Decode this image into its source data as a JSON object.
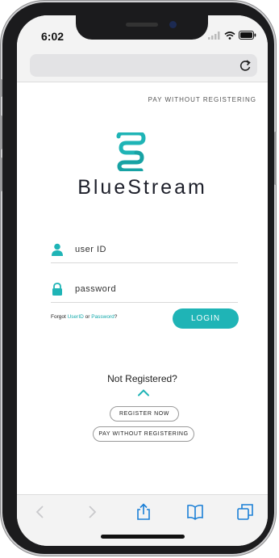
{
  "status": {
    "time": "6:02"
  },
  "browser": {
    "url": ""
  },
  "page": {
    "top_link": "PAY WITHOUT REGISTERING",
    "brand": "BlueStream",
    "user_placeholder": "user ID",
    "password_placeholder": "password",
    "forgot_prefix": "Forgot ",
    "forgot_userid": "UserID",
    "forgot_or": " or ",
    "forgot_password": "Password",
    "forgot_suffix": "?",
    "login_label": "LOGIN",
    "not_registered": "Not Registered?",
    "register_label": "REGISTER NOW",
    "pay_label": "PAY WITHOUT REGISTERING"
  },
  "colors": {
    "accent": "#1fb4b6",
    "link": "#14a9ab",
    "brand_text": "#1d1f2a"
  },
  "toolbar": {
    "items": [
      "back-icon",
      "forward-icon",
      "share-icon",
      "bookmarks-icon",
      "tabs-icon"
    ]
  }
}
